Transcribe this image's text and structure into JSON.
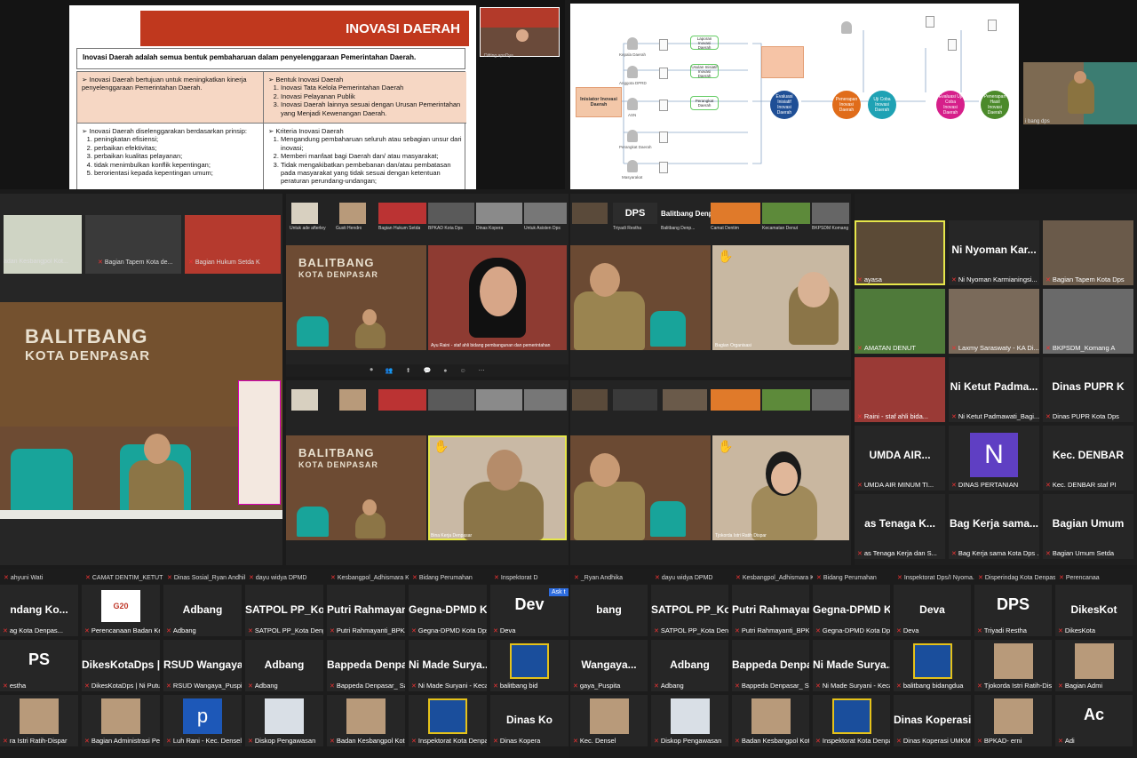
{
  "slide": {
    "title": "INOVASI DAERAH",
    "definition": "Inovasi Daerah adalah semua bentuk pembaharuan dalam penyelenggaraan Pemerintahan Daerah.",
    "purpose": "➢ Inovasi Daerah bertujuan untuk meningkatkan kinerja penyelenggaraan Pemerintahan Daerah.",
    "forms_title": "➢ Bentuk Inovasi Daerah",
    "forms": [
      "Inovasi Tata Kelola Pemerintahan Daerah",
      "Inovasi Pelayanan Publik",
      "Inovasi Daerah lainnya sesuai dengan Urusan Pemerintahan yang Menjadi Kewenangan Daerah."
    ],
    "principles_title": "➢ Inovasi Daerah diselenggarakan berdasarkan prinsip:",
    "principles": [
      "peningkatan efisiensi;",
      "perbaikan efektivitas;",
      "perbaikan kualitas pelayanan;",
      "tidak menimbulkan konflik kepentingan;",
      "berorientasi kepada kepentingan umum;"
    ],
    "criteria_title": "➢ Kriteria Inovasi Daerah",
    "criteria": [
      "Mengandung pembaharuan seluruh atau sebagian unsur dari inovasi;",
      "Memberi manfaat bagi Daerah dan/ atau masyarakat;",
      "Tidak mengakibatkan pembebanan dan/atau pembatasan pada masyarakat yang tidak sesuai dengan ketentuan peraturan perundang-undangan;"
    ],
    "mini_label": "Ditting apoDya"
  },
  "diagram": {
    "initiator": "Inisiator Inovasi Daerah",
    "nodes": [
      "Evaluasi Inisiatif Inovasi Daerah",
      "Penerapan Inovasi Daerah",
      "Uji Coba Inovasi Daerah",
      "Evaluasi Uji Coba Inovasi Daerah",
      "Penerapan Hasil Inovasi Daerah"
    ],
    "actors": [
      "Kepala Daerah",
      "Anggota DPRD",
      "ASN",
      "Perangkat Daerah",
      "Masyarakat"
    ],
    "boxes": [
      "Laporan Inovasi Daerah",
      "Usulan Inisiatif Inovasi Daerah",
      "Perangkat Daerah"
    ],
    "presenter_label": "i bang dps"
  },
  "participants": {
    "left_thumbs": [
      "adan Kesbangpol Kot...",
      "Bagian Tapem Kota de...",
      "Bagian Hukum Setda K"
    ],
    "room_sign": [
      "BALITBANG",
      "KOTA DENPASAR"
    ],
    "mid_top_left_label": "Ayu Raini - staf ahli bidang pembangunan dan pemerintahan",
    "mid_bottom_left_label": "Bina Kerja Denpasar",
    "mid_top_right_label": "Bagian Organisasi",
    "mid_bottom_right_label": "Tjokorda Istri Ratih Dispar",
    "strip_top_left": [
      "Untuk ade afterley",
      "Gusti Hendro",
      "Bagian Hukum Setda",
      "BPKAD Kota Dps",
      "Dinas Kopera",
      "Untuk Asisten Dps"
    ],
    "strip_top_right": [
      "Triyadi Restha",
      "Balitbang Denp...",
      "Camat Dentim",
      "Kecamatan Denut",
      "BKPSDM Komang"
    ],
    "balitbang_label": "Balitbang Denp..."
  },
  "right_grid": [
    {
      "name": "",
      "label": "ayasa"
    },
    {
      "name": "Ni Nyoman Kar...",
      "label": "Ni Nyoman Karmianingsi..."
    },
    {
      "name": "",
      "label": "Bagian Tapem Kota Dps"
    },
    {
      "name": "",
      "label": "AMATAN DENUT"
    },
    {
      "name": "",
      "label": "Laxmy Saraswaty - KA Di..."
    },
    {
      "name": "",
      "label": "BKPSDM_Komang A"
    },
    {
      "name": "",
      "label": "Raini - staf ahli bida..."
    },
    {
      "name": "Ni Ketut Padma...",
      "label": "Ni Ketut Padmawati_Bagi..."
    },
    {
      "name": "Dinas PUPR K",
      "label": "Dinas PUPR Kota Dps"
    },
    {
      "name": "UMDA AIR...",
      "label": "UMDA AIR MINUM TI..."
    },
    {
      "name": "N",
      "label": "DINAS PERTANIAN"
    },
    {
      "name": "Kec. DENBAR",
      "label": "Kec. DENBAR staf PI"
    },
    {
      "name": "as Tenaga K...",
      "label": "as Tenaga Kerja dan S..."
    },
    {
      "name": "Bag Kerja sama...",
      "label": "Bag Kerja sama Kota Dps ..."
    },
    {
      "name": "Bagian Umum",
      "label": "Bagian Umum Setda"
    }
  ],
  "bottom_left": {
    "labels": [
      "ahyuni Wati",
      "CAMAT DENTIM_KETUT S...",
      "Dinas Sosial_Ryan Andhika",
      "dayu widya DPMD",
      "Kesbangpol_Adhismara K...",
      "Bidang Perumahan",
      "Inspektorat D"
    ],
    "row1": [
      {
        "name": "ndang Ko...",
        "label": "ag Kota Denpas..."
      },
      {
        "name": "G20",
        "label": "Perencanaan Badan Kesb..."
      },
      {
        "name": "Adbang",
        "label": "Adbang"
      },
      {
        "name": "SATPOL PP_Kot...",
        "label": "SATPOL PP_Kota Denpasar"
      },
      {
        "name": "Putri Rahmayan...",
        "label": "Putri Rahmayanti_BPKAD"
      },
      {
        "name": "Gegna-DPMD K...",
        "label": "Gegna-DPMD Kota Dps"
      },
      {
        "name": "Dev",
        "label": "Deva"
      }
    ],
    "row2": [
      {
        "name": "PS",
        "label": "estha"
      },
      {
        "name": "DikesKotaDps |...",
        "label": "DikesKotaDps | Ni Putu M..."
      },
      {
        "name": "RSUD Wangaya...",
        "label": "RSUD Wangaya_Puspita"
      },
      {
        "name": "Adbang",
        "label": "Adbang"
      },
      {
        "name": "Bappeda Denpa...",
        "label": "Bappeda Denpasar_ Sari ..."
      },
      {
        "name": "Ni Made Surya...",
        "label": "Ni Made Suryani - Kecam..."
      },
      {
        "name": "",
        "label": "balitbang bid"
      }
    ],
    "row3": [
      {
        "name": "",
        "label": "ra Istri Ratih-Dispar"
      },
      {
        "name": "",
        "label": "Bagian Administrasi Pem..."
      },
      {
        "name": "p",
        "label": "Luh Rani - Kec. Densel"
      },
      {
        "name": "",
        "label": "Diskop Pengawasan"
      },
      {
        "name": "",
        "label": "Badan Kesbangpol Kota ..."
      },
      {
        "name": "",
        "label": "Inspektorat Kota Denpasar"
      },
      {
        "name": "Dinas Ko",
        "label": "Dinas Kopera"
      }
    ],
    "ask": "Ask t"
  },
  "bottom_right": {
    "labels": [
      "_Ryan Andhika",
      "dayu widya DPMD",
      "Kesbangpol_Adhismara K...",
      "Bidang Perumahan",
      "Inspektorat Dps/I Nyoma...",
      "Disperindag Kota Denpas...",
      "Perencanaa"
    ],
    "row1": [
      {
        "name": "bang",
        "label": ""
      },
      {
        "name": "SATPOL PP_Kot...",
        "label": "SATPOL PP_Kota Denpasar"
      },
      {
        "name": "Putri Rahmayan...",
        "label": "Putri Rahmayanti_BPKAD"
      },
      {
        "name": "Gegna-DPMD K...",
        "label": "Gegna-DPMD Kota Dps"
      },
      {
        "name": "Deva",
        "label": "Deva"
      },
      {
        "name": "DPS",
        "label": "Triyadi Restha"
      },
      {
        "name": "DikesKot",
        "label": "DikesKota"
      }
    ],
    "row2": [
      {
        "name": "Wangaya...",
        "label": "gaya_Puspita"
      },
      {
        "name": "Adbang",
        "label": "Adbang"
      },
      {
        "name": "Bappeda Denpa...",
        "label": "Bappeda Denpasar_ Sari ..."
      },
      {
        "name": "Ni Made Surya...",
        "label": "Ni Made Suryani - Kecam..."
      },
      {
        "name": "",
        "label": "balitbang bidangdua"
      },
      {
        "name": "",
        "label": "Tjokorda Istri Ratih-Dispar"
      },
      {
        "name": "",
        "label": "Bagian Admi"
      }
    ],
    "row3": [
      {
        "name": "",
        "label": "Kec. Densel"
      },
      {
        "name": "",
        "label": "Diskop Pengawasan"
      },
      {
        "name": "",
        "label": "Badan Kesbangpol Kota ..."
      },
      {
        "name": "",
        "label": "Inspektorat Kota Denpasar"
      },
      {
        "name": "Dinas Koperasi...",
        "label": "Dinas Koperasi UMKM Ko..."
      },
      {
        "name": "",
        "label": "BPKAD- erni"
      },
      {
        "name": "Ac",
        "label": "Adi"
      }
    ]
  },
  "colors": {
    "slide_accent": "#c0381e",
    "speaker_border": "#e6e64a",
    "muted_mic": "#e33333"
  }
}
